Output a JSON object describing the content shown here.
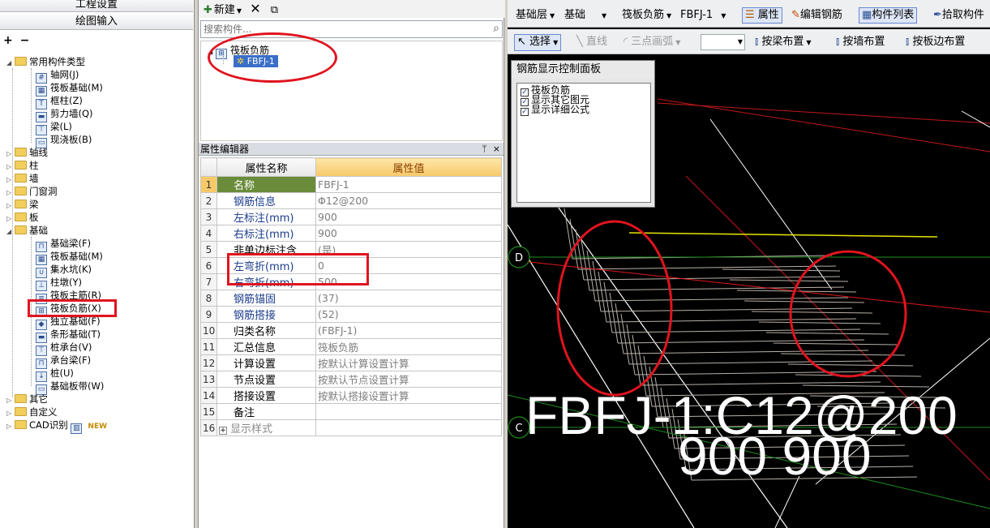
{
  "left_panel": {
    "nav_settings": "工程设置",
    "nav_draw": "绘图输入",
    "tree_tools": {
      "expand": "+",
      "collapse": "−"
    },
    "tree": {
      "common_types": "常用构件类型",
      "common_items": [
        "轴网(J)",
        "筏板基础(M)",
        "框柱(Z)",
        "剪力墙(Q)",
        "梁(L)",
        "现浇板(B)"
      ],
      "axis": "轴线",
      "column": "柱",
      "wall": "墙",
      "door": "门窗洞",
      "beam": "梁",
      "slab": "板",
      "foundation": "基础",
      "foundation_items": [
        "基础梁(F)",
        "筏板基础(M)",
        "集水坑(K)",
        "柱墩(Y)",
        "筏板主筋(R)",
        "筏板负筋(X)",
        "独立基础(F)",
        "条形基础(T)",
        "桩承台(V)",
        "承台梁(F)",
        "桩(U)",
        "基础板带(W)"
      ],
      "other": "其它",
      "custom": "自定义",
      "cad": "CAD识别",
      "new_badge": "NEW"
    }
  },
  "mid_panel": {
    "new_label": "新建",
    "search_placeholder": "搜索构件...",
    "comp_tree": {
      "root": "筏板负筋",
      "child": "FBFJ-1"
    },
    "prop_editor_title": "属性编辑器",
    "prop_editor_pin": "ᛘ",
    "prop_editor_close": "×",
    "columns": {
      "name": "属性名称",
      "value": "属性值"
    },
    "rows": [
      {
        "n": "1",
        "name": "名称",
        "value": "FBFJ-1"
      },
      {
        "n": "2",
        "name": "钢筋信息",
        "value": "Φ12@200"
      },
      {
        "n": "3",
        "name": "左标注(mm)",
        "value": "900"
      },
      {
        "n": "4",
        "name": "右标注(mm)",
        "value": "900"
      },
      {
        "n": "5",
        "name": "非单边标注含",
        "value": "(是)"
      },
      {
        "n": "6",
        "name": "左弯折(mm)",
        "value": "0"
      },
      {
        "n": "7",
        "name": "右弯折(mm)",
        "value": "500"
      },
      {
        "n": "8",
        "name": "钢筋锚固",
        "value": "(37)"
      },
      {
        "n": "9",
        "name": "钢筋搭接",
        "value": "(52)"
      },
      {
        "n": "10",
        "name": "归类名称",
        "value": "(FBFJ-1)"
      },
      {
        "n": "11",
        "name": "汇总信息",
        "value": "筏板负筋"
      },
      {
        "n": "12",
        "name": "计算设置",
        "value": "按默认计算设置计算"
      },
      {
        "n": "13",
        "name": "节点设置",
        "value": "按默认节点设置计算"
      },
      {
        "n": "14",
        "name": "搭接设置",
        "value": "按默认搭接设置计算"
      },
      {
        "n": "15",
        "name": "备注",
        "value": ""
      },
      {
        "n": "16",
        "name": "显示样式",
        "value": ""
      }
    ]
  },
  "right_area": {
    "toolbar1": {
      "floor": "基础层",
      "type": "基础",
      "component_type": "筏板负筋",
      "component": "FBFJ-1",
      "properties": "属性",
      "edit_rebar": "编辑钢筋",
      "component_list": "构件列表",
      "pick": "拾取构件"
    },
    "toolbar2": {
      "select": "选择",
      "line": "直线",
      "arc": "三点画弧",
      "by_beam": "按梁布置",
      "by_wall": "按墙布置",
      "by_slab_edge": "按板边布置"
    },
    "steel_panel": {
      "title": "钢筋显示控制面板",
      "options": [
        "筏板负筋",
        "显示其它图元",
        "显示详细公式"
      ]
    },
    "canvas": {
      "label_main": "FBFJ-1:C12@200",
      "label_dims": "900 900",
      "axis_d": "D",
      "axis_c": "C"
    }
  },
  "colors": {
    "annotation_red": "#e0141e",
    "selected_row_green": "#6a8c3a",
    "value_header_orange": "#f7c968",
    "rebar_gray": "#b8b0a8",
    "axis_green": "#1e8f1e",
    "canvas_black": "#000000"
  }
}
